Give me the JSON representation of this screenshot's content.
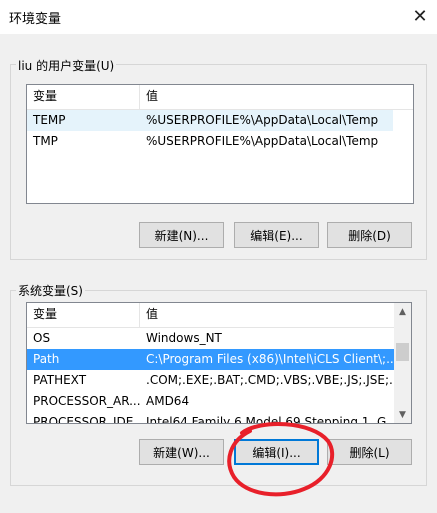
{
  "window": {
    "title": "环境变量",
    "close_glyph": "✕"
  },
  "user_vars": {
    "group_label": "liu 的用户变量(U)",
    "columns": [
      "变量",
      "值"
    ],
    "rows": [
      {
        "name": "TEMP",
        "value": "%USERPROFILE%\\AppData\\Local\\Temp"
      },
      {
        "name": "TMP",
        "value": "%USERPROFILE%\\AppData\\Local\\Temp"
      }
    ],
    "buttons": {
      "new": "新建(N)...",
      "edit": "编辑(E)...",
      "delete": "删除(D)"
    }
  },
  "system_vars": {
    "group_label": "系统变量(S)",
    "columns": [
      "变量",
      "值"
    ],
    "rows": [
      {
        "name": "OS",
        "value": "Windows_NT"
      },
      {
        "name": "Path",
        "value": "C:\\Program Files (x86)\\Intel\\iCLS Client\\;..."
      },
      {
        "name": "PATHEXT",
        "value": ".COM;.EXE;.BAT;.CMD;.VBS;.VBE;.JS;.JSE;..."
      },
      {
        "name": "PROCESSOR_AR...",
        "value": "AMD64"
      },
      {
        "name": "PROCESSOR_IDE...",
        "value": "Intel64 Family 6 Model 69 Stepping 1, G..."
      }
    ],
    "selected_index": 1,
    "buttons": {
      "new": "新建(W)...",
      "edit": "编辑(I)...",
      "delete": "删除(L)"
    }
  },
  "icons": {
    "scroll_up": "scroll-up-arrow-icon",
    "scroll_down": "scroll-down-arrow-icon",
    "close": "close-icon"
  },
  "colors": {
    "selection": "#3399ff",
    "hover": "#e5f3fb",
    "annotation": "#e8202a",
    "focus_border": "#0078d7"
  }
}
